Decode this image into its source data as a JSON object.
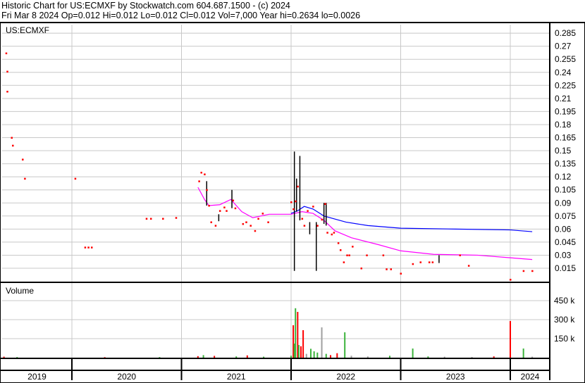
{
  "header": {
    "title": "Historic Chart for US:ECMXF by Stockwatch.com 604.687.1500 - (c) 2024",
    "quote": "Fri Mar  8 2024  Op=0.012  Hi=0.012  Lo=0.012  Cl=0.012  Vol=7,000  Year hi=0.2634  lo=0.0026"
  },
  "colors": {
    "close": "#ff0000",
    "ma_long": "#0000ff",
    "ma_short": "#ff00ff",
    "vol_up": "#3cb33c",
    "vol_down": "#ff0000",
    "vol_flat": "#a0a0a0",
    "grid": "#c8c8c8"
  },
  "chart_data": [
    {
      "type": "scatter",
      "title": "US:ECMXF",
      "xlabel": "",
      "ylabel": "",
      "xlim": [
        2019.36,
        2024.35
      ],
      "ylim": [
        0.0,
        0.295
      ],
      "y_ticks": [
        "0.015",
        "0.03",
        "0.045",
        "0.06",
        "0.075",
        "0.09",
        "0.105",
        "0.12",
        "0.135",
        "0.15",
        "0.165",
        "0.18",
        "0.195",
        "0.21",
        "0.225",
        "0.24",
        "0.255",
        "0.27",
        "0.285"
      ],
      "grid": true,
      "closes": [
        [
          2019.4,
          0.262
        ],
        [
          2019.41,
          0.241
        ],
        [
          2019.41,
          0.218
        ],
        [
          2019.45,
          0.165
        ],
        [
          2019.46,
          0.156
        ],
        [
          2019.55,
          0.14
        ],
        [
          2019.57,
          0.118
        ],
        [
          2020.03,
          0.118
        ],
        [
          2020.12,
          0.039
        ],
        [
          2020.15,
          0.039
        ],
        [
          2020.18,
          0.039
        ],
        [
          2020.68,
          0.072
        ],
        [
          2020.72,
          0.072
        ],
        [
          2020.83,
          0.072
        ],
        [
          2020.95,
          0.073
        ],
        [
          2021.16,
          0.115
        ],
        [
          2021.18,
          0.125
        ],
        [
          2021.21,
          0.123
        ],
        [
          2021.23,
          0.105
        ],
        [
          2021.25,
          0.087
        ],
        [
          2021.27,
          0.068
        ],
        [
          2021.31,
          0.064
        ],
        [
          2021.35,
          0.081
        ],
        [
          2021.39,
          0.085
        ],
        [
          2021.41,
          0.081
        ],
        [
          2021.47,
          0.093
        ],
        [
          2021.49,
          0.084
        ],
        [
          2021.56,
          0.066
        ],
        [
          2021.59,
          0.068
        ],
        [
          2021.63,
          0.064
        ],
        [
          2021.67,
          0.058
        ],
        [
          2021.7,
          0.072
        ],
        [
          2021.74,
          0.078
        ],
        [
          2021.79,
          0.068
        ],
        [
          2022.0,
          0.091
        ],
        [
          2022.02,
          0.083
        ],
        [
          2022.04,
          0.092
        ],
        [
          2022.06,
          0.109
        ],
        [
          2022.1,
          0.072
        ],
        [
          2022.12,
          0.064
        ],
        [
          2022.15,
          0.081
        ],
        [
          2022.2,
          0.086
        ],
        [
          2022.24,
          0.064
        ],
        [
          2022.28,
          0.071
        ],
        [
          2022.31,
          0.089
        ],
        [
          2022.33,
          0.056
        ],
        [
          2022.37,
          0.054
        ],
        [
          2022.39,
          0.056
        ],
        [
          2022.43,
          0.044
        ],
        [
          2022.45,
          0.036
        ],
        [
          2022.48,
          0.022
        ],
        [
          2022.51,
          0.03
        ],
        [
          2022.53,
          0.03
        ],
        [
          2022.56,
          0.04
        ],
        [
          2022.64,
          0.015
        ],
        [
          2022.69,
          0.03
        ],
        [
          2022.84,
          0.03
        ],
        [
          2022.87,
          0.014
        ],
        [
          2022.91,
          0.014
        ],
        [
          2023.0,
          0.009
        ],
        [
          2023.11,
          0.02
        ],
        [
          2023.18,
          0.022
        ],
        [
          2023.26,
          0.022
        ],
        [
          2023.29,
          0.022
        ],
        [
          2023.54,
          0.03
        ],
        [
          2023.62,
          0.018
        ],
        [
          2024.0,
          0.002
        ],
        [
          2024.12,
          0.012
        ],
        [
          2024.2,
          0.012
        ]
      ],
      "ranges": [
        [
          2021.23,
          0.115,
          0.087
        ],
        [
          2021.34,
          0.077,
          0.069
        ],
        [
          2021.46,
          0.105,
          0.084
        ],
        [
          2022.03,
          0.149,
          0.012
        ],
        [
          2022.05,
          0.118,
          0.08
        ],
        [
          2022.08,
          0.144,
          0.07
        ],
        [
          2022.17,
          0.068,
          0.054
        ],
        [
          2022.23,
          0.068,
          0.012
        ],
        [
          2022.3,
          0.09,
          0.066
        ],
        [
          2022.32,
          0.09,
          0.064
        ],
        [
          2023.35,
          0.03,
          0.021
        ]
      ],
      "series": [
        {
          "name": "long moving average",
          "color": "#0000ff",
          "points": [
            [
              2022.0,
              0.078
            ],
            [
              2022.06,
              0.081
            ],
            [
              2022.12,
              0.086
            ],
            [
              2022.2,
              0.083
            ],
            [
              2022.3,
              0.075
            ],
            [
              2022.5,
              0.068
            ],
            [
              2022.7,
              0.064
            ],
            [
              2023.0,
              0.061
            ],
            [
              2023.5,
              0.06
            ],
            [
              2024.0,
              0.059
            ],
            [
              2024.2,
              0.057
            ]
          ]
        },
        {
          "name": "short moving average",
          "color": "#ff00ff",
          "points": [
            [
              2021.15,
              0.108
            ],
            [
              2021.21,
              0.094
            ],
            [
              2021.25,
              0.087
            ],
            [
              2021.35,
              0.088
            ],
            [
              2021.45,
              0.094
            ],
            [
              2021.55,
              0.08
            ],
            [
              2021.65,
              0.073
            ],
            [
              2021.8,
              0.077
            ],
            [
              2022.0,
              0.077
            ],
            [
              2022.1,
              0.08
            ],
            [
              2022.2,
              0.078
            ],
            [
              2022.3,
              0.07
            ],
            [
              2022.4,
              0.058
            ],
            [
              2022.55,
              0.05
            ],
            [
              2022.8,
              0.042
            ],
            [
              2023.0,
              0.035
            ],
            [
              2023.3,
              0.031
            ],
            [
              2023.7,
              0.03
            ],
            [
              2024.0,
              0.027
            ],
            [
              2024.2,
              0.025
            ]
          ]
        }
      ]
    },
    {
      "type": "bar",
      "title": "Volume",
      "ylim": [
        0,
        560
      ],
      "y_ticks": [
        "150 k",
        "300 k",
        "450 k"
      ],
      "y_tick_values": [
        150,
        300,
        450
      ],
      "x_ticks": [
        "2019",
        "2020",
        "2021",
        "2022",
        "2023",
        "2024"
      ],
      "x_tick_years": [
        2019,
        2020,
        2021,
        2022,
        2023,
        2024
      ],
      "bars_k": [
        [
          2019.38,
          8,
          "r"
        ],
        [
          2019.5,
          5,
          "g"
        ],
        [
          2020.3,
          4,
          "r"
        ],
        [
          2020.8,
          5,
          "g"
        ],
        [
          2021.15,
          12,
          "r"
        ],
        [
          2021.2,
          20,
          "g"
        ],
        [
          2021.3,
          14,
          "r"
        ],
        [
          2021.5,
          10,
          "g"
        ],
        [
          2021.6,
          18,
          "r"
        ],
        [
          2021.75,
          8,
          "g"
        ],
        [
          2022.0,
          15,
          "g"
        ],
        [
          2022.02,
          256,
          "r"
        ],
        [
          2022.03,
          111,
          "g"
        ],
        [
          2022.04,
          390,
          "g"
        ],
        [
          2022.06,
          361,
          "r"
        ],
        [
          2022.07,
          100,
          "g"
        ],
        [
          2022.09,
          90,
          "r"
        ],
        [
          2022.11,
          217,
          "r"
        ],
        [
          2022.14,
          30,
          "f"
        ],
        [
          2022.18,
          70,
          "g"
        ],
        [
          2022.21,
          50,
          "g"
        ],
        [
          2022.24,
          40,
          "g"
        ],
        [
          2022.28,
          239,
          "f"
        ],
        [
          2022.32,
          30,
          "g"
        ],
        [
          2022.36,
          20,
          "r"
        ],
        [
          2022.42,
          35,
          "r"
        ],
        [
          2022.49,
          200,
          "g"
        ],
        [
          2022.55,
          15,
          "f"
        ],
        [
          2022.7,
          10,
          "f"
        ],
        [
          2022.9,
          15,
          "g"
        ],
        [
          2023.11,
          72,
          "g"
        ],
        [
          2023.25,
          10,
          "g"
        ],
        [
          2023.4,
          8,
          "f"
        ],
        [
          2023.65,
          6,
          "f"
        ],
        [
          2023.85,
          10,
          "r"
        ],
        [
          2024.0,
          289,
          "r"
        ],
        [
          2024.12,
          72,
          "g"
        ],
        [
          2024.2,
          8,
          "f"
        ]
      ]
    }
  ]
}
